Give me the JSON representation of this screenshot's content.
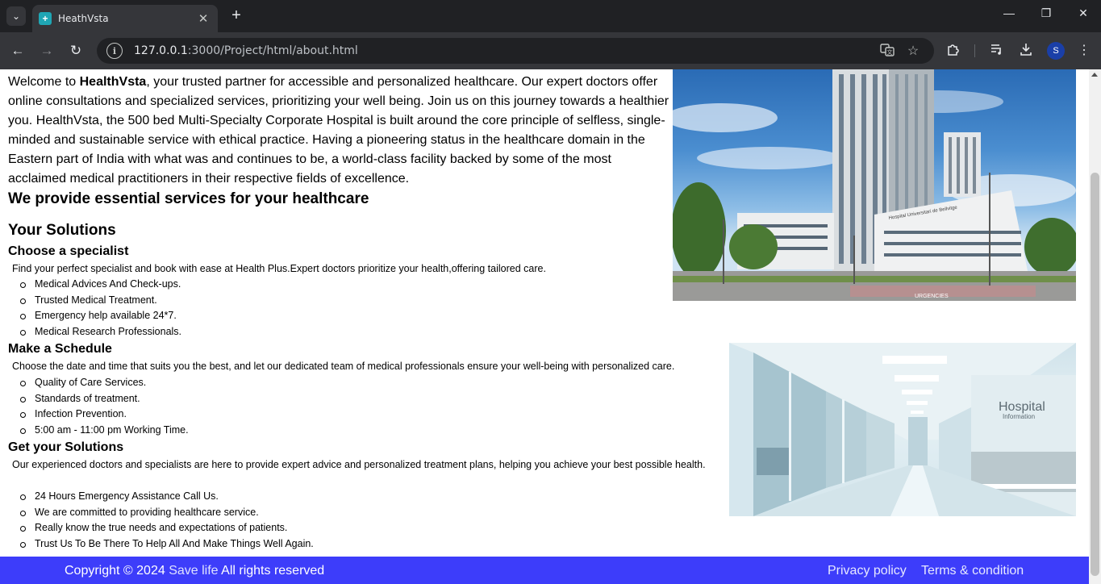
{
  "browser": {
    "tab_title": "HeathVsta",
    "tab_close": "✕",
    "new_tab": "+",
    "url_host": "127.0.0.1",
    "url_path": ":3000/Project/html/about.html",
    "profile_initial": "S",
    "window": {
      "minimize": "—",
      "maximize": "❐",
      "close": "✕"
    }
  },
  "page": {
    "intro": {
      "lead": "Welcome to ",
      "brand": "HealthVsta",
      "rest": ", your trusted partner for accessible and personalized healthcare. Our expert doctors offer online consultations and specialized services, prioritizing your well being. Join us on this journey towards a healthier you. HealthVsta, the 500 bed Multi-Specialty Corporate Hospital is built around the core principle of selfless, single-minded and sustainable service with ethical practice. Having a pioneering status in the healthcare domain in the Eastern part of India with what was and continues to be, a world-class facility backed by some of the most acclaimed medical practitioners in their respective fields of excellence."
    },
    "essential_heading": "We provide essential services for your healthcare",
    "solutions_heading": "Your Solutions",
    "sections": [
      {
        "title": "Choose a specialist",
        "desc": "Find your perfect specialist and book with ease at Health Plus.Expert doctors prioritize your health,offering tailored care.",
        "items": [
          "Medical Advices And Check-ups.",
          "Trusted Medical Treatment.",
          "Emergency help available 24*7.",
          "Medical Research Professionals."
        ]
      },
      {
        "title": "Make a Schedule",
        "desc": "Choose the date and time that suits you the best, and let our dedicated team of medical professionals ensure your well-being with personalized care.",
        "items": [
          "Quality of Care Services.",
          "Standards of treatment.",
          "Infection Prevention.",
          "5:00 am - 11:00 pm Working Time."
        ]
      },
      {
        "title": "Get your Solutions",
        "desc": "Our experienced doctors and specialists are here to provide expert advice and personalized treatment plans, helping you achieve your best possible health.",
        "items": [
          "24 Hours Emergency Assistance Call Us.",
          "We are committed to providing healthcare service.",
          "Really know the true needs and expectations of patients.",
          "Trust Us To Be There To Help All And Make Things Well Again."
        ]
      }
    ],
    "building_image": {
      "sign": "URGENCIES",
      "facade": "Hospital Universitari de Bellvitge"
    },
    "hall_image": {
      "sign_title": "Hospital",
      "sign_sub": "Information"
    },
    "footer": {
      "copyright": "Copyright © 2024",
      "brand_link": "Save life",
      "rights": "All rights reserved",
      "privacy": "Privacy policy",
      "terms": "Terms & condition"
    }
  },
  "colors": {
    "footer_bg": "#3d3dfa",
    "chrome_dark": "#202124",
    "chrome_toolbar": "#35363a"
  }
}
